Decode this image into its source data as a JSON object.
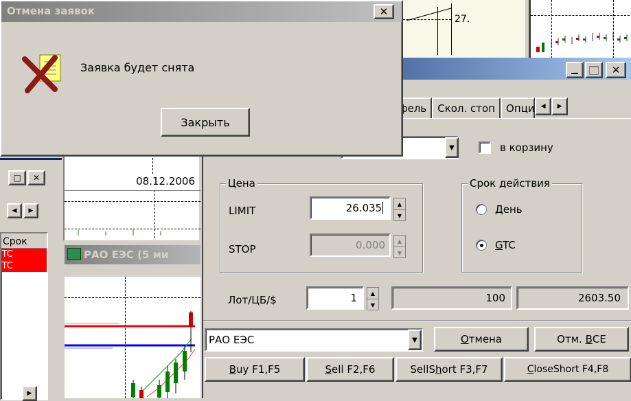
{
  "dialog": {
    "title": "Отмена заявок",
    "message": "Заявка будет снята",
    "close_button": "Закрыть"
  },
  "background_chart_top": {
    "price_label": "27."
  },
  "left_panel": {
    "date_label": "08.12.2006",
    "column_header": "Срок",
    "rows": [
      "GTC",
      "GTC"
    ]
  },
  "chart_window": {
    "title": "РАО ЕЭС (5 ми"
  },
  "order_window": {
    "tabs": [
      "тфель",
      "Скол. стоп",
      "Опци"
    ],
    "basket_checkbox_label": "в корзину",
    "price_group": {
      "legend": "Цена",
      "limit_label": "LIMIT",
      "limit_value": "26.035",
      "stop_label": "STOP",
      "stop_value": "0.000"
    },
    "validity_group": {
      "legend": "Срок действия",
      "day_label_pre": "",
      "day_label_u": "Д",
      "day_label_post": "ень",
      "gtc_label_u": "G",
      "gtc_label_post": "TC",
      "selected": "GTC"
    },
    "lot_label": "Лот/ЦБ/$",
    "lot_value": "1",
    "lot_size": "100",
    "total": "2603.50",
    "instrument": "РАО ЕЭС",
    "cancel_button_u": "О",
    "cancel_button_post": "тмена",
    "cancel_all_pre": "Отм. ",
    "cancel_all_u": "В",
    "cancel_all_post": "СЕ",
    "buy_u": "B",
    "buy_post": "uy F1,F5",
    "sell_u": "S",
    "sell_post": "ell F2,F6",
    "sellshort_pre": "SellS",
    "sellshort_u": "h",
    "sellshort_post": "ort F3,F7",
    "closeshort_u": "C",
    "closeshort_post": "loseShort F4,F8"
  },
  "colors": {
    "title_inactive": "#808080",
    "title_active": "#0a246a",
    "chart_bg": "#f8f8e8",
    "gtc_red": "#ff0000"
  }
}
